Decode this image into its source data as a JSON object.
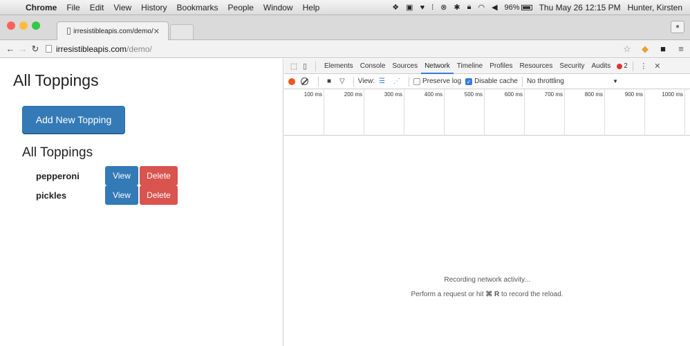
{
  "menubar": {
    "app": "Chrome",
    "items": [
      "File",
      "Edit",
      "View",
      "History",
      "Bookmarks",
      "People",
      "Window",
      "Help"
    ],
    "battery": "96%",
    "datetime": "Thu May 26  12:15 PM",
    "user": "Hunter, Kirsten"
  },
  "tab": {
    "title": "irresistibleapis.com/demo/"
  },
  "address": {
    "host": "irresistibleapis.com",
    "path": "/demo/"
  },
  "page": {
    "title": "All Toppings",
    "add_button": "Add New Topping",
    "subtitle": "All Toppings",
    "toppings": [
      {
        "name": "pepperoni",
        "view": "View",
        "delete": "Delete"
      },
      {
        "name": "pickles",
        "view": "View",
        "delete": "Delete"
      }
    ]
  },
  "devtools": {
    "tabs": [
      "Elements",
      "Console",
      "Sources",
      "Network",
      "Timeline",
      "Profiles",
      "Resources",
      "Security",
      "Audits"
    ],
    "active_tab": "Network",
    "error_count": "2",
    "toolbar": {
      "view_label": "View:",
      "preserve_log": "Preserve log",
      "disable_cache": "Disable cache",
      "throttling": "No throttling"
    },
    "ticks": [
      "100 ms",
      "200 ms",
      "300 ms",
      "400 ms",
      "500 ms",
      "600 ms",
      "700 ms",
      "800 ms",
      "900 ms",
      "1000 ms"
    ],
    "empty_line1": "Recording network activity...",
    "empty_line2_pre": "Perform a request or hit ",
    "empty_line2_key": "⌘ R",
    "empty_line2_post": " to record the reload."
  },
  "colors": {
    "primary": "#337ab7",
    "danger": "#d9534f",
    "devtools_accent": "#3879d9"
  }
}
